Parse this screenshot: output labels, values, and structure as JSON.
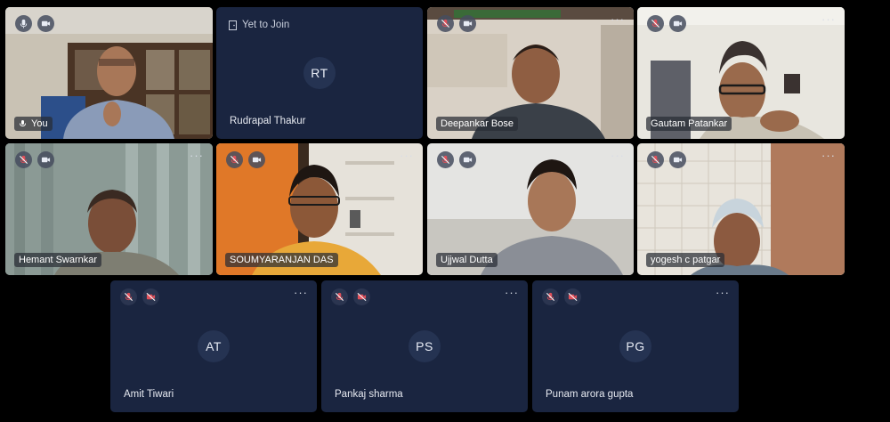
{
  "participants": [
    {
      "name": "You",
      "mic": "on",
      "camera": "on",
      "video": true
    },
    {
      "name": "Rudrapal Thakur",
      "initials": "RT",
      "status": "Yet to Join"
    },
    {
      "name": "Deepankar Bose",
      "mic": "muted",
      "camera": "on",
      "video": true
    },
    {
      "name": "Gautam Patankar",
      "mic": "muted",
      "camera": "on",
      "video": true
    },
    {
      "name": "Hemant Swarnkar",
      "mic": "muted",
      "camera": "on",
      "video": true
    },
    {
      "name": "SOUMYARANJAN DAS",
      "mic": "muted",
      "camera": "on",
      "video": true
    },
    {
      "name": "Ujjwal Dutta",
      "mic": "muted",
      "camera": "on",
      "video": true
    },
    {
      "name": "yogesh c patgar",
      "mic": "muted",
      "camera": "on",
      "video": true
    },
    {
      "name": "Amit Tiwari",
      "initials": "AT",
      "mic": "muted",
      "camera": "off"
    },
    {
      "name": "Pankaj sharma",
      "initials": "PS",
      "mic": "muted",
      "camera": "off"
    },
    {
      "name": "Punam arora gupta",
      "initials": "PG",
      "mic": "muted",
      "camera": "off"
    }
  ],
  "more_label": "···",
  "icons": {
    "mic": "mic-icon",
    "mic_muted": "mic-muted-icon",
    "camera": "camera-icon",
    "camera_off": "camera-off-icon",
    "door": "door-icon",
    "speaking": "speaking-icon"
  },
  "colors": {
    "page_bg": "#000000",
    "tile_bg": "#1a2540",
    "avatar_circle": "#253352",
    "muted_red": "#e0505a"
  }
}
